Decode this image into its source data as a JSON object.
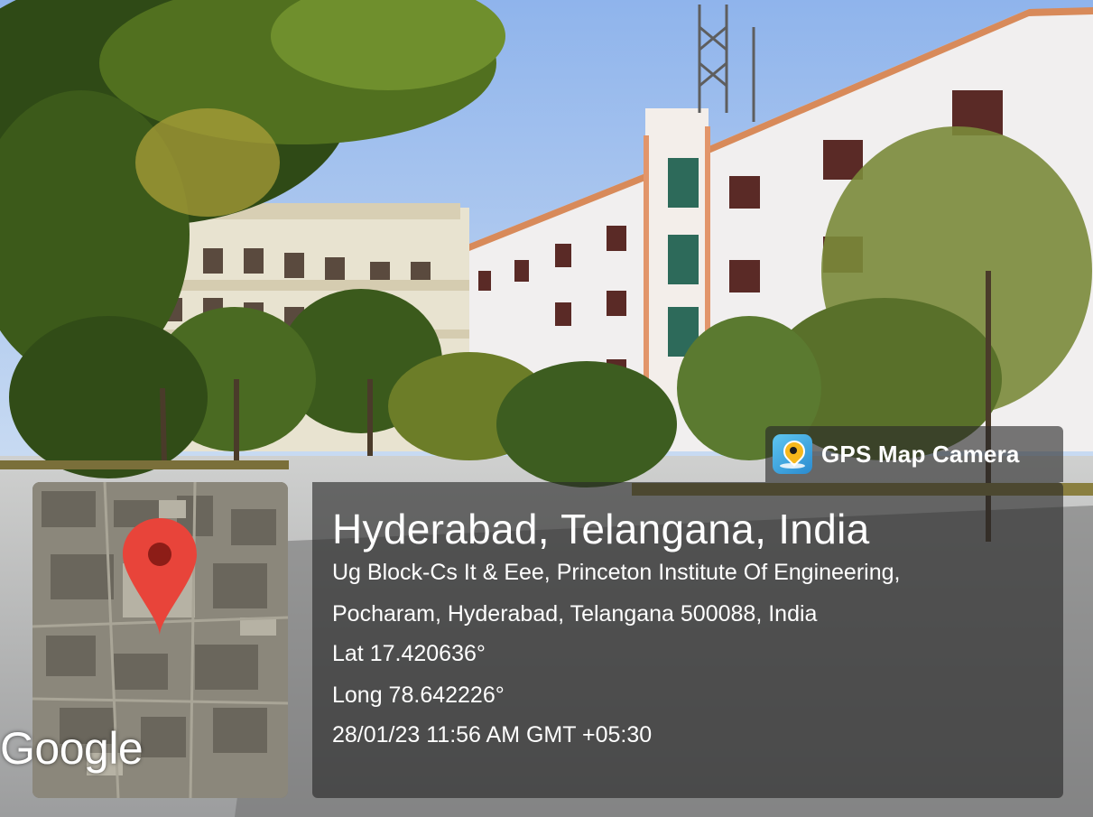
{
  "app": {
    "badge_label": "GPS Map Camera",
    "badge_icon": "location-pin-camera-icon"
  },
  "map": {
    "watermark": "Google",
    "marker_icon": "map-marker-icon",
    "marker_color": "#e8443a"
  },
  "location": {
    "title": "Hyderabad, Telangana, India",
    "address_line1": "Ug Block-Cs It & Eee, Princeton Institute Of Engineering,",
    "address_line2": "Pocharam, Hyderabad, Telangana 500088, India",
    "latitude": "Lat 17.420636°",
    "longitude": "Long 78.642226°",
    "timestamp": "28/01/23 11:56 AM GMT +05:30"
  }
}
